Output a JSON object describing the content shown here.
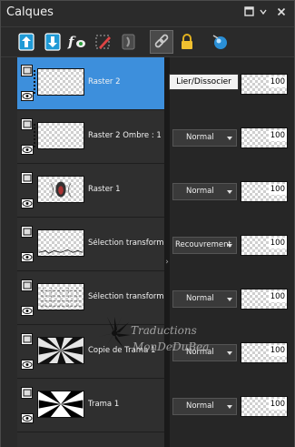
{
  "panel": {
    "title": "Calques"
  },
  "tooltip": "Lier/Dissocier",
  "watermark": {
    "line1": "Traductions",
    "line2": "MonDeDuBea"
  },
  "toolbar": {
    "tools": [
      "new-raster-layer-icon",
      "merge-down-icon",
      "new-adjustment-layer-icon",
      "edit-selection-icon",
      "layer-mask-icon",
      "link-unlink-icon",
      "lock-icon",
      "layer-properties-icon"
    ],
    "active": "link-unlink-icon"
  },
  "titlebar": {
    "buttons": [
      "maximize-icon",
      "close-icon"
    ]
  },
  "layers": [
    {
      "name": "Raster 2",
      "blend": "",
      "opacity": "100",
      "selected": true
    },
    {
      "name": "Raster 2 Ombre : 1",
      "blend": "Normal",
      "opacity": "100",
      "selected": false
    },
    {
      "name": "Raster 1",
      "blend": "Normal",
      "opacity": "100",
      "selected": false
    },
    {
      "name": "Sélection transformée",
      "blend": "Recouvrement",
      "opacity": "100",
      "selected": false
    },
    {
      "name": "Sélection transformée",
      "blend": "Normal",
      "opacity": "100",
      "selected": false
    },
    {
      "name": "Copie de Trama 1",
      "blend": "Normal",
      "opacity": "100",
      "selected": false
    },
    {
      "name": "Trama 1",
      "blend": "Normal",
      "opacity": "100",
      "selected": false
    }
  ],
  "colors": {
    "selected_row": "#3d8fdc",
    "panel_bg": "#242424"
  }
}
